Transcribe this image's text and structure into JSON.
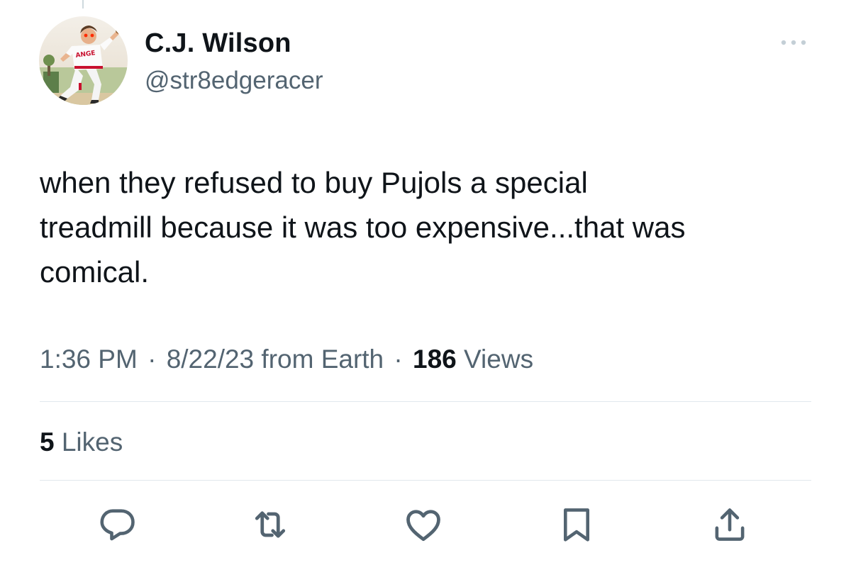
{
  "author": {
    "display_name": "C.J. Wilson",
    "handle": "@str8edgeracer",
    "avatar_jersey_text": "ANGE"
  },
  "tweet": {
    "text": "when they refused to buy Pujols a special\ntreadmill because it was too expensive...that was\ncomical.",
    "time": "1:36 PM",
    "date": "8/22/23",
    "source": "from Earth",
    "separator": "·",
    "views_count": "186",
    "views_label": "Views",
    "likes_count": "5",
    "likes_label": "Likes"
  },
  "icons": {
    "more": "more-dots-icon",
    "reply": "reply-bubble-icon",
    "retweet": "retweet-icon",
    "like": "heart-icon",
    "bookmark": "bookmark-icon",
    "share": "share-icon"
  },
  "colors": {
    "text_primary": "#0f1419",
    "text_secondary": "#536471",
    "divider": "#e1e8ed",
    "icon": "#536471"
  }
}
